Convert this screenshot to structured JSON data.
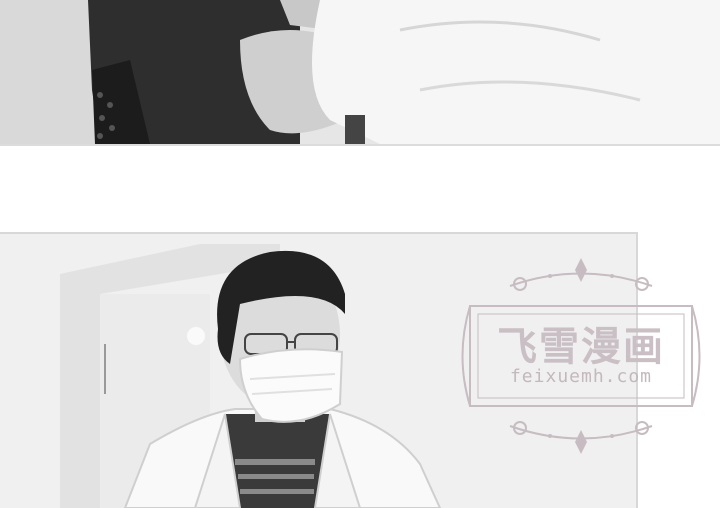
{
  "watermark": {
    "title": "飞雪漫画",
    "url": "feixuemh.com"
  },
  "colors": {
    "background": "#ffffff",
    "watermark": "#c6bcc1"
  }
}
